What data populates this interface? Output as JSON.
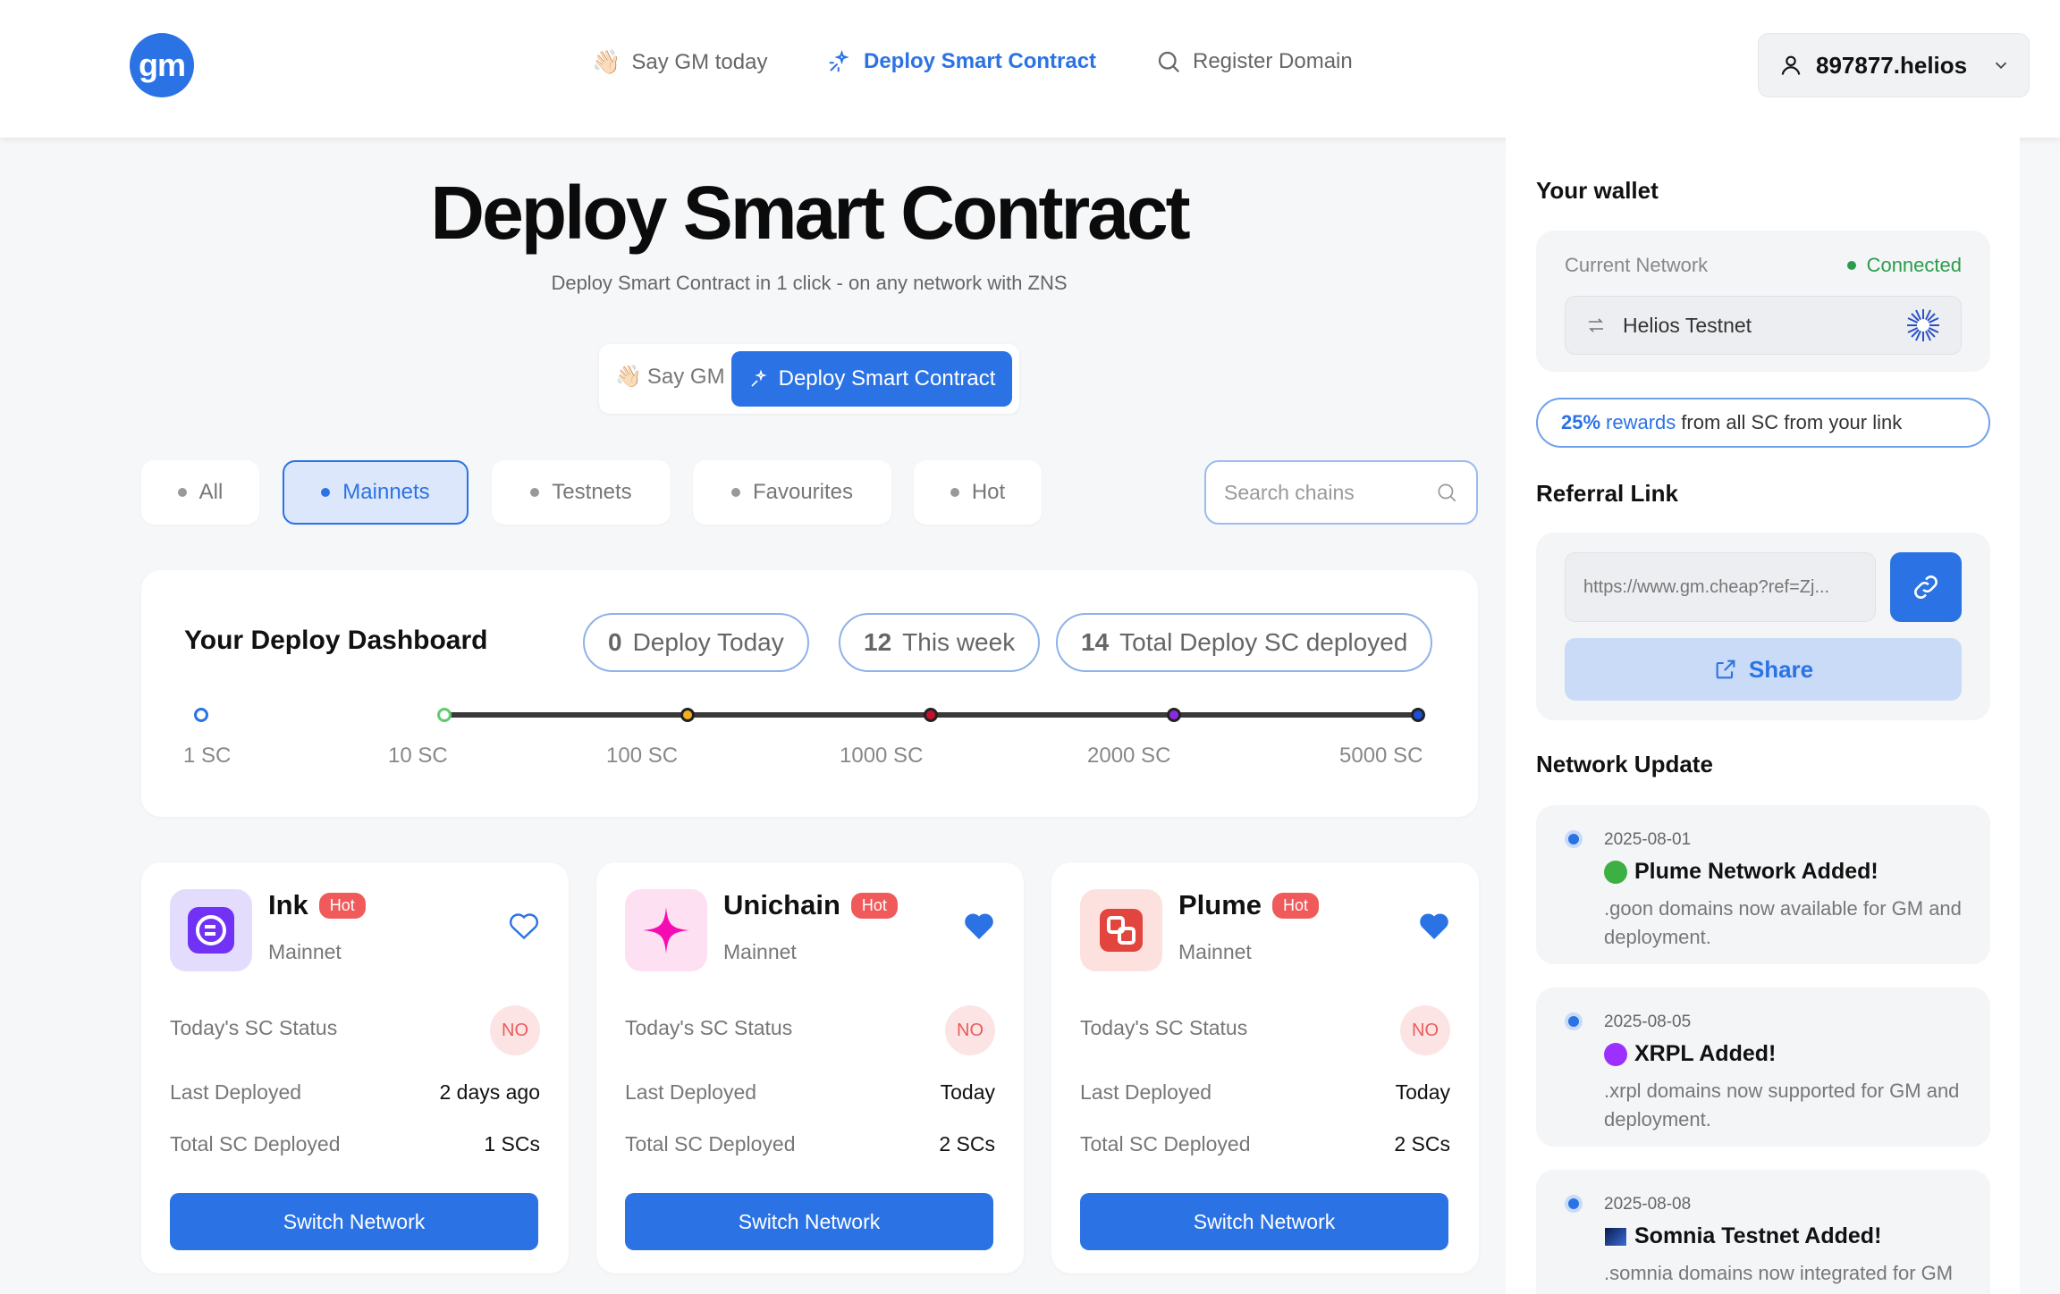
{
  "header": {
    "logo": "gm",
    "nav": [
      {
        "label": "Say GM today",
        "icon": "wave-hand-icon"
      },
      {
        "label": "Deploy Smart Contract",
        "icon": "deploy-icon"
      },
      {
        "label": "Register Domain",
        "icon": "search-icon"
      }
    ],
    "user": "897877.helios"
  },
  "hero": {
    "title": "Deploy Smart Contract",
    "subtitle": "Deploy Smart Contract in 1 click - on any network with ZNS",
    "switch_gm": "Say GM",
    "switch_deploy": "Deploy Smart Contract"
  },
  "filters": [
    "All",
    "Mainnets",
    "Testnets",
    "Favourites",
    "Hot"
  ],
  "search": {
    "placeholder": "Search chains"
  },
  "dashboard": {
    "title": "Your Deploy Dashboard",
    "today_count": "0",
    "today_label": "Deploy Today",
    "week_count": "12",
    "week_label": "This week",
    "total_count": "14",
    "total_label": "Total Deploy SC deployed",
    "milestones": [
      "1 SC",
      "10 SC",
      "100 SC",
      "1000 SC",
      "2000 SC",
      "5000 SC"
    ],
    "milestone_colors": [
      "#2b73e4",
      "#5fcc6b",
      "#f2b01e",
      "#c2132e",
      "#8a2be2",
      "#1e4fd8"
    ]
  },
  "cards": [
    {
      "name": "Ink",
      "hot": "Hot",
      "type": "Mainnet",
      "status_label": "Today's SC Status",
      "status": "NO",
      "last_label": "Last Deployed",
      "last": "2 days ago",
      "total_label": "Total SC Deployed",
      "total": "1 SCs",
      "button": "Switch Network",
      "favourite": false,
      "color": "#7132f5"
    },
    {
      "name": "Unichain",
      "hot": "Hot",
      "type": "Mainnet",
      "status_label": "Today's SC Status",
      "status": "NO",
      "last_label": "Last Deployed",
      "last": "Today",
      "total_label": "Total SC Deployed",
      "total": "2 SCs",
      "button": "Switch Network",
      "favourite": true,
      "color": "#f50db4"
    },
    {
      "name": "Plume",
      "hot": "Hot",
      "type": "Mainnet",
      "status_label": "Today's SC Status",
      "status": "NO",
      "last_label": "Last Deployed",
      "last": "Today",
      "total_label": "Total SC Deployed",
      "total": "2 SCs",
      "button": "Switch Network",
      "favourite": true,
      "color": "#e2453e"
    }
  ],
  "wallet": {
    "title": "Your wallet",
    "network_label": "Current Network",
    "status": "Connected",
    "network": "Helios Testnet"
  },
  "reward": {
    "pct": "25%",
    "word": "rewards",
    "rest": "from all SC from your link"
  },
  "referral": {
    "title": "Referral Link",
    "url": "https://www.gm.cheap?ref=Zj...",
    "share": "Share"
  },
  "updates": {
    "title": "Network Update",
    "items": [
      {
        "date": "2025-08-01",
        "title": "Plume Network Added!",
        "desc": ".goon domains now available for GM and deployment.",
        "marker": "#3cb043"
      },
      {
        "date": "2025-08-05",
        "title": "XRPL Added!",
        "desc": ".xrpl domains now supported for GM and deployment.",
        "marker": "#9b30ff"
      },
      {
        "date": "2025-08-08",
        "title": "Somnia Testnet Added!",
        "desc": ".somnia domains now integrated for GM functionality.",
        "marker": "#1e3a8a"
      }
    ]
  }
}
